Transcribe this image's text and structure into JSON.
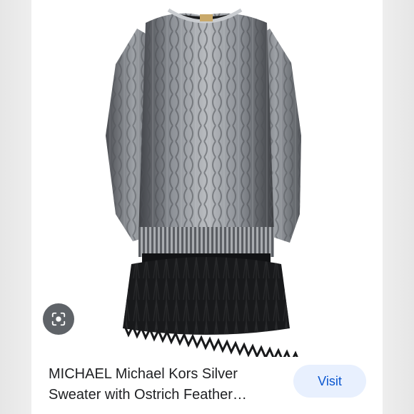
{
  "result": {
    "title_line1": "MICHAEL Michael Kors Silver",
    "title_line2": "Sweater with Ostrich Feather…",
    "visit_label": "Visit",
    "image_subject": "silver cable-knit sweater dress with black ostrich feather hem"
  },
  "icons": {
    "lens": "google-lens-icon"
  },
  "colors": {
    "visit_bg": "#e8f0fe",
    "visit_text": "#0b57d0",
    "lens_bg": "#5f6368",
    "title_text": "#202124"
  }
}
